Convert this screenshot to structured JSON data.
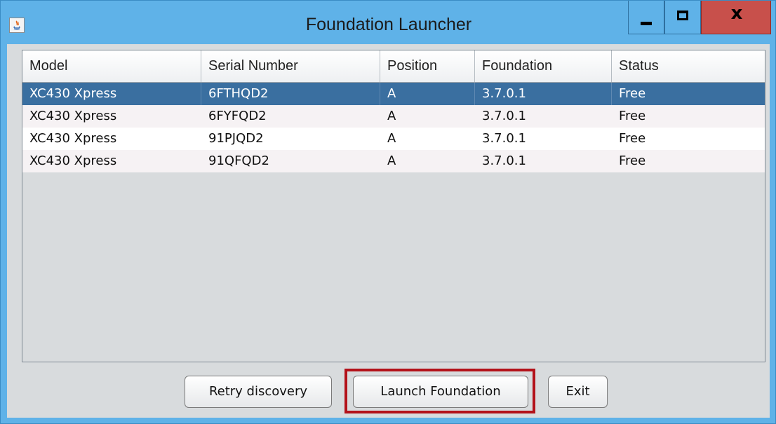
{
  "window": {
    "title": "Foundation Launcher",
    "app_icon": "java-icon",
    "controls": {
      "minimize": "minimize-icon",
      "maximize": "maximize-icon",
      "close_label": "x"
    }
  },
  "table": {
    "columns": [
      "Model",
      "Serial Number",
      "Position",
      "Foundation",
      "Status"
    ],
    "rows": [
      [
        "XC430 Xpress",
        "6FTHQD2",
        "A",
        "3.7.0.1",
        "Free"
      ],
      [
        "XC430 Xpress",
        "6FYFQD2",
        "A",
        "3.7.0.1",
        "Free"
      ],
      [
        "XC430 Xpress",
        "91PJQD2",
        "A",
        "3.7.0.1",
        "Free"
      ],
      [
        "XC430 Xpress",
        "91QFQD2",
        "A",
        "3.7.0.1",
        "Free"
      ]
    ],
    "selected_row": 0
  },
  "buttons": {
    "retry": "Retry discovery",
    "launch": "Launch Foundation",
    "exit": "Exit"
  },
  "colors": {
    "titlebar": "#5fb2e8",
    "close_button": "#c8504b",
    "selection": "#3a6fa0",
    "highlight_box": "#b3121a"
  }
}
